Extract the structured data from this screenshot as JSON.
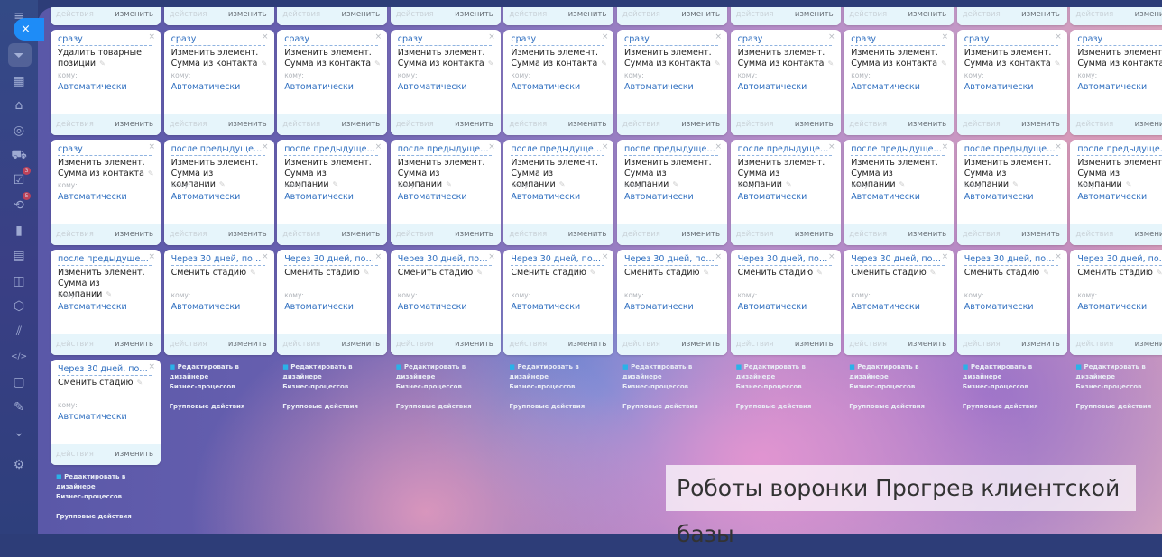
{
  "sidebar": {
    "close_icon": "×",
    "icons": [
      {
        "name": "menu-icon",
        "glyph": "≡"
      },
      {
        "name": "funnel-icon",
        "glyph": "⏷"
      },
      {
        "name": "calendar-icon",
        "glyph": "▦"
      },
      {
        "name": "store-icon",
        "glyph": "⌂"
      },
      {
        "name": "target-icon",
        "glyph": "◎"
      },
      {
        "name": "cart-icon",
        "glyph": "⛟"
      },
      {
        "name": "tasks-icon",
        "glyph": "☑",
        "badge": "3"
      },
      {
        "name": "flows-icon",
        "glyph": "⟲",
        "badge": "5"
      },
      {
        "name": "analytics-icon",
        "glyph": "▮"
      },
      {
        "name": "contact-center-icon",
        "glyph": "▤"
      },
      {
        "name": "robot-icon",
        "glyph": "◫"
      },
      {
        "name": "market-icon",
        "glyph": "⬡"
      },
      {
        "name": "automation-icon",
        "glyph": "⫽"
      },
      {
        "name": "code-icon",
        "glyph": "</>"
      },
      {
        "name": "document-icon",
        "glyph": "▢"
      },
      {
        "name": "sign-icon",
        "glyph": "✎"
      },
      {
        "name": "more-icon",
        "glyph": "⌄"
      },
      {
        "name": "settings-icon",
        "glyph": "⚙"
      }
    ]
  },
  "labels": {
    "recipient": "кому:",
    "actions": "действия",
    "edit": "изменить",
    "designer_line1": "Редактировать в дизайнере",
    "designer_line2": "Бизнес-процессов",
    "group_actions": "Групповые действия",
    "pencil_icon": "✎",
    "lock_icon": "🔒"
  },
  "colors": {
    "accent": "#2f6fc0",
    "close_button": "#1e8cf7",
    "footer": "#e6f5fb"
  },
  "columns": [
    {
      "cards": [
        {
          "trigger": "",
          "title": "",
          "recipient": "",
          "partial": true
        },
        {
          "trigger": "сразу",
          "title": "Удалить товарные позиции",
          "recipient": "Автоматически"
        },
        {
          "trigger": "сразу",
          "title": "Изменить элемент. Сумма из контакта",
          "recipient": "Автоматически"
        },
        {
          "trigger": "после предыдущего, п...",
          "title": "Изменить элемент. Сумма из компании",
          "recipient": "Автоматически"
        },
        {
          "trigger": "Через 30 дней, после ...",
          "title": "Сменить стадию",
          "recipient": "Автоматически"
        }
      ]
    },
    {
      "cards": "standard"
    },
    {
      "cards": "standard"
    },
    {
      "cards": "standard"
    },
    {
      "cards": "standard"
    },
    {
      "cards": "standard"
    },
    {
      "cards": "standard"
    },
    {
      "cards": "standard"
    },
    {
      "cards": "standard"
    },
    {
      "cards": "standard"
    }
  ],
  "standard_cards": [
    {
      "trigger": "",
      "title": "",
      "recipient": "",
      "partial": true
    },
    {
      "trigger": "сразу",
      "title": "Изменить элемент. Сумма из контакта",
      "recipient": "Автоматически"
    },
    {
      "trigger": "после предыдущего, п...",
      "title": "Изменить элемент. Сумма из компании",
      "recipient": "Автоматически"
    },
    {
      "trigger": "Через 30 дней, после ...",
      "title": "Сменить стадию",
      "recipient": "Автоматически"
    }
  ],
  "caption": "Роботы воронки Прогрев клиентской базы"
}
